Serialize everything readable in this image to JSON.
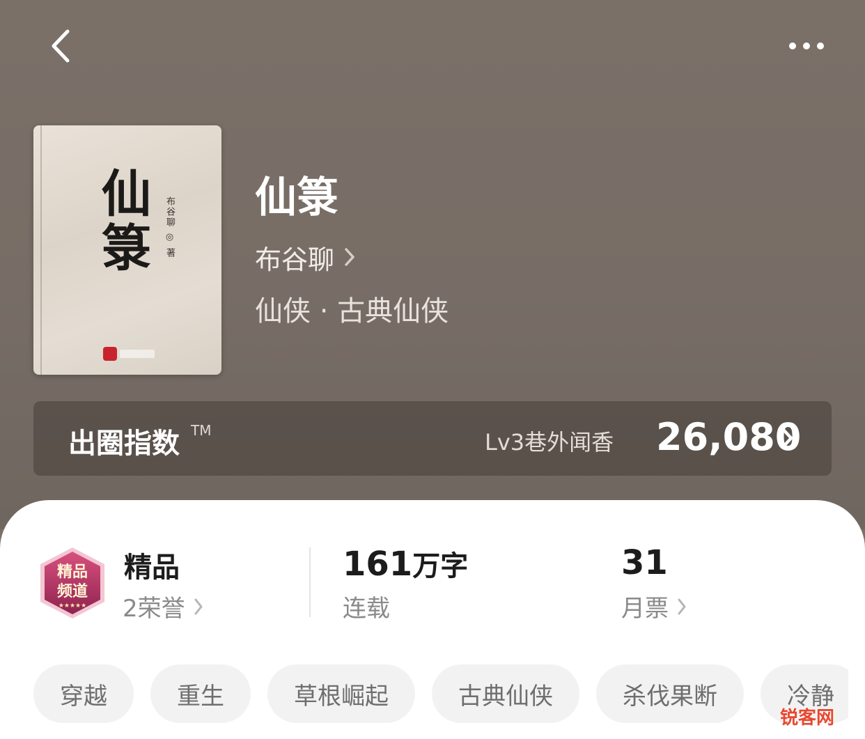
{
  "header": {
    "back_icon": "chevron-left-icon",
    "more_icon": "more-horizontal-icon"
  },
  "book": {
    "cover_title": "仙箓",
    "cover_author": "布谷聊 ◎ 著",
    "title": "仙箓",
    "author": "布谷聊",
    "genre": "仙侠 · 古典仙侠"
  },
  "index": {
    "label": "出圈指数",
    "tm": "TM",
    "level": "Lv3巷外闻香",
    "value": "26,080"
  },
  "stats": {
    "quality": {
      "title": "精品",
      "sub": "2荣誉"
    },
    "words": {
      "number": "161",
      "unit": "万字",
      "sub": "连载"
    },
    "tickets": {
      "number": "31",
      "sub": "月票"
    }
  },
  "tags": [
    "穿越",
    "重生",
    "草根崛起",
    "古典仙侠",
    "杀伐果断",
    "冷静"
  ],
  "watermark": "锐客网",
  "colors": {
    "hero_bg": "#7a7068",
    "card_bg": "#ffffff",
    "tag_bg": "#f2f2f2",
    "badge_pink": "#b8336a"
  }
}
